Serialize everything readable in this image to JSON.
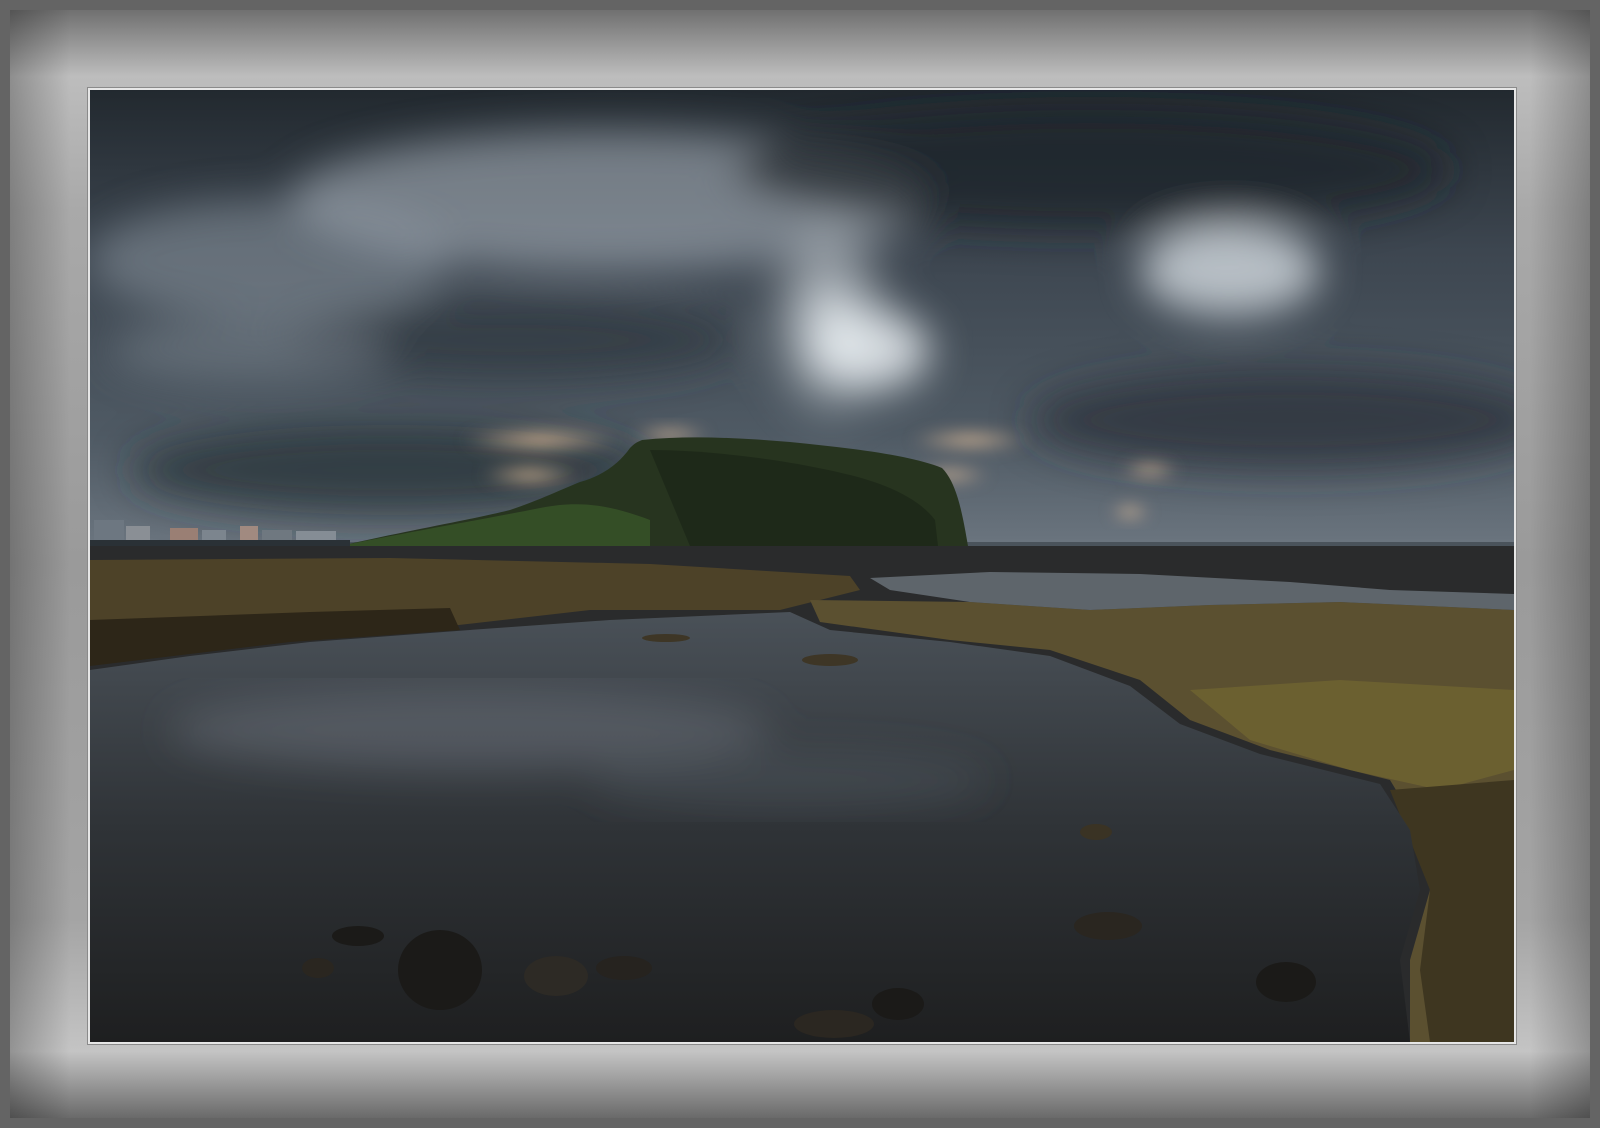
{
  "photo": {
    "subject": "",
    "colors": {
      "sky_dark": "#1f262c",
      "sky_mid": "#4a5560",
      "sky_light": "#c9d2d8",
      "mountain": "#27351f",
      "sea": "#3b434a",
      "rock": "#4c4127",
      "algae": "#6b5e2c",
      "pool": "#2a2d30"
    }
  }
}
